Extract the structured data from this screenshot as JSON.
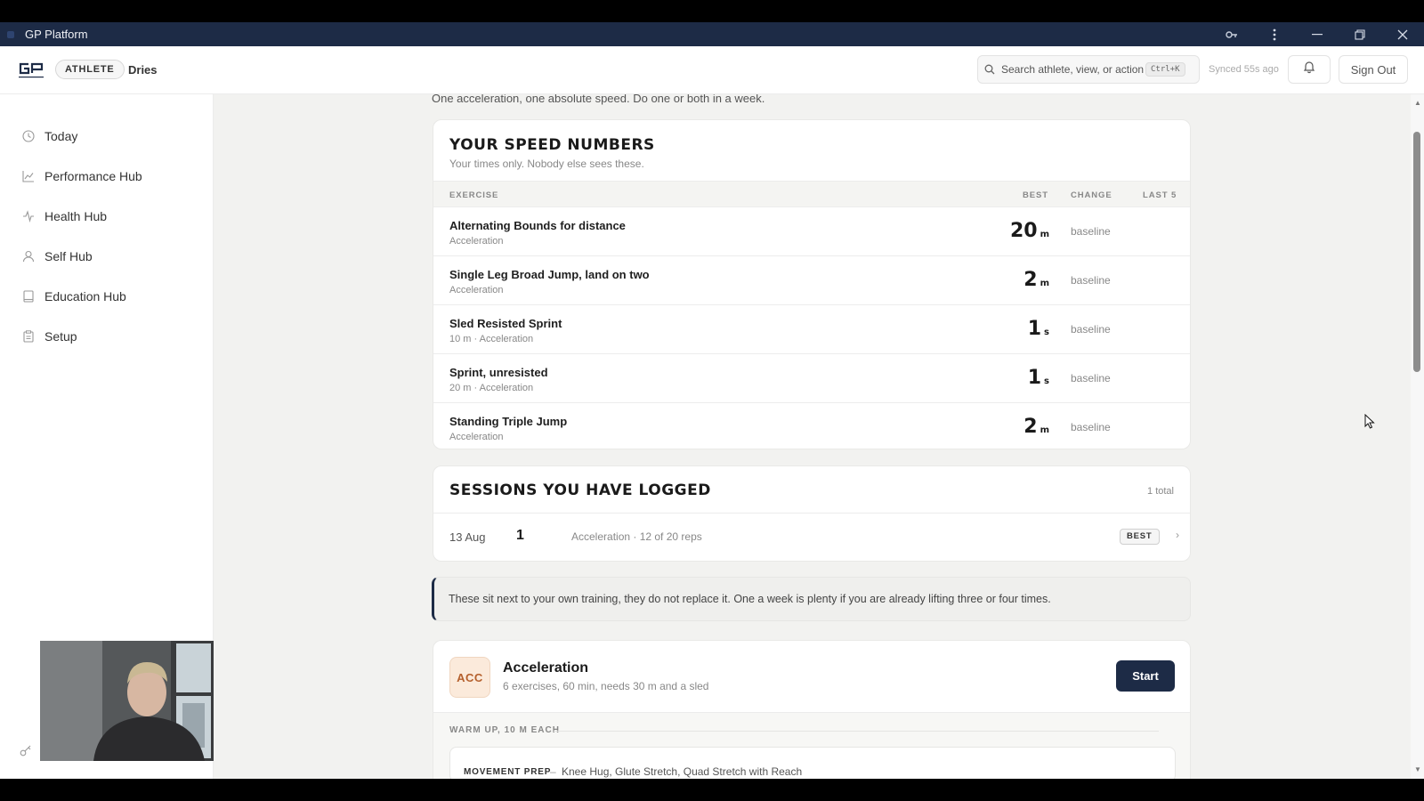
{
  "window": {
    "title": "GP Platform",
    "controls": [
      "key-icon",
      "more-vertical-icon",
      "minimize-icon",
      "restore-icon",
      "close-icon"
    ]
  },
  "header": {
    "role": "ATHLETE",
    "user": "Dries",
    "search_placeholder": "Search athlete, view, or action",
    "search_shortcut": "Ctrl+K",
    "synced": "Synced 55s ago",
    "signout": "Sign Out"
  },
  "sidebar": {
    "items": [
      {
        "label": "Today",
        "icon": "clock-icon"
      },
      {
        "label": "Performance Hub",
        "icon": "chart-line-icon"
      },
      {
        "label": "Health Hub",
        "icon": "activity-icon"
      },
      {
        "label": "Self Hub",
        "icon": "user-icon"
      },
      {
        "label": "Education Hub",
        "icon": "book-icon"
      },
      {
        "label": "Setup",
        "icon": "clipboard-icon"
      }
    ]
  },
  "main": {
    "intro": "One acceleration, one absolute speed. Do one or both in a week.",
    "speed": {
      "title": "YOUR SPEED NUMBERS",
      "subtitle": "Your times only. Nobody else sees these.",
      "columns": [
        "EXERCISE",
        "BEST",
        "CHANGE",
        "LAST 5"
      ],
      "rows": [
        {
          "name": "Alternating Bounds for distance",
          "meta": "Acceleration",
          "best": "20",
          "unit": "m",
          "change": "baseline"
        },
        {
          "name": "Single Leg Broad Jump, land on two",
          "meta": "Acceleration",
          "best": "2",
          "unit": "m",
          "change": "baseline"
        },
        {
          "name": "Sled Resisted Sprint",
          "meta": "10 m · Acceleration",
          "best": "1",
          "unit": "s",
          "change": "baseline"
        },
        {
          "name": "Sprint, unresisted",
          "meta": "20 m · Acceleration",
          "best": "1",
          "unit": "s",
          "change": "baseline"
        },
        {
          "name": "Standing Triple Jump",
          "meta": "Acceleration",
          "best": "2",
          "unit": "m",
          "change": "baseline"
        }
      ]
    },
    "sessions": {
      "title": "SESSIONS YOU HAVE LOGGED",
      "total": "1 total",
      "rows": [
        {
          "date": "13 Aug",
          "count": "1",
          "desc": "Acceleration · 12 of 20 reps",
          "badge": "BEST"
        }
      ]
    },
    "note": "These sit next to your own training, they do not replace it. One a week is plenty if you are already lifting three or four times.",
    "program": {
      "badge": "ACC",
      "title": "Acceleration",
      "subtitle": "6 exercises, 60 min, needs 30 m and a sled",
      "start": "Start",
      "section": "WARM UP, 10 M EACH",
      "movement_label": "MOVEMENT PREP",
      "movement_items": "Knee Hug, Glute Stretch, Quad Stretch with Reach"
    }
  }
}
